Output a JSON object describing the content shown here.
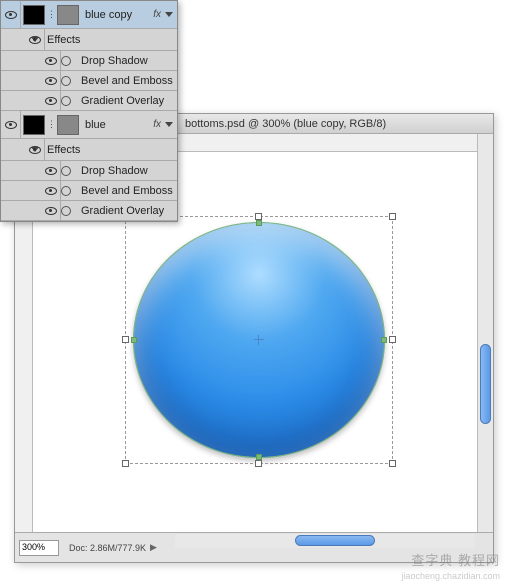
{
  "layers": [
    {
      "name": "blue copy",
      "selected": true,
      "fx": true,
      "effects_label": "Effects",
      "effects": [
        "Drop Shadow",
        "Bevel and Emboss",
        "Gradient Overlay"
      ]
    },
    {
      "name": "blue",
      "selected": false,
      "fx": true,
      "effects_label": "Effects",
      "effects": [
        "Drop Shadow",
        "Bevel and Emboss",
        "Gradient Overlay"
      ]
    }
  ],
  "document": {
    "title": "bottoms.psd @ 300% (blue copy, RGB/8)",
    "zoom": "300%",
    "doc_size": "Doc: 2.86M/777.9K"
  },
  "watermark": {
    "main": "查字典 教程网",
    "sub": "jiaocheng.chazidian.com"
  }
}
